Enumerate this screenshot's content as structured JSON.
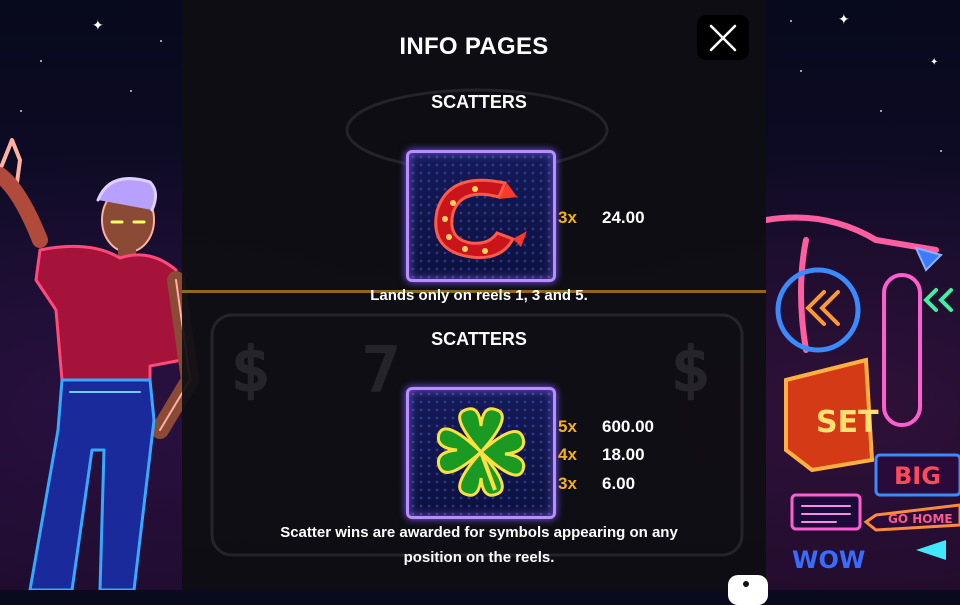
{
  "dialog": {
    "title": "INFO PAGES",
    "close_icon": "close-icon"
  },
  "sections": [
    {
      "heading": "SCATTERS",
      "symbol": "horseshoe-icon",
      "payouts": [
        {
          "mult": "3x",
          "value": "24.00"
        }
      ],
      "note": "Lands only on reels 1, 3 and 5."
    },
    {
      "heading": "SCATTERS",
      "symbol": "four-leaf-clover-icon",
      "payouts": [
        {
          "mult": "5x",
          "value": "600.00"
        },
        {
          "mult": "4x",
          "value": "18.00"
        },
        {
          "mult": "3x",
          "value": "6.00"
        }
      ],
      "note_line1": "Scatter wins are awarded for symbols appearing on any",
      "note_line2": "position on the reels."
    }
  ],
  "background": {
    "signs": [
      "SET",
      "BIG",
      "GO HOME",
      "WOW"
    ]
  },
  "colors": {
    "panel": "#0e0e12",
    "multiplier": "#f3b21b",
    "tile_border": "#b98cff",
    "text": "#ffffff"
  }
}
